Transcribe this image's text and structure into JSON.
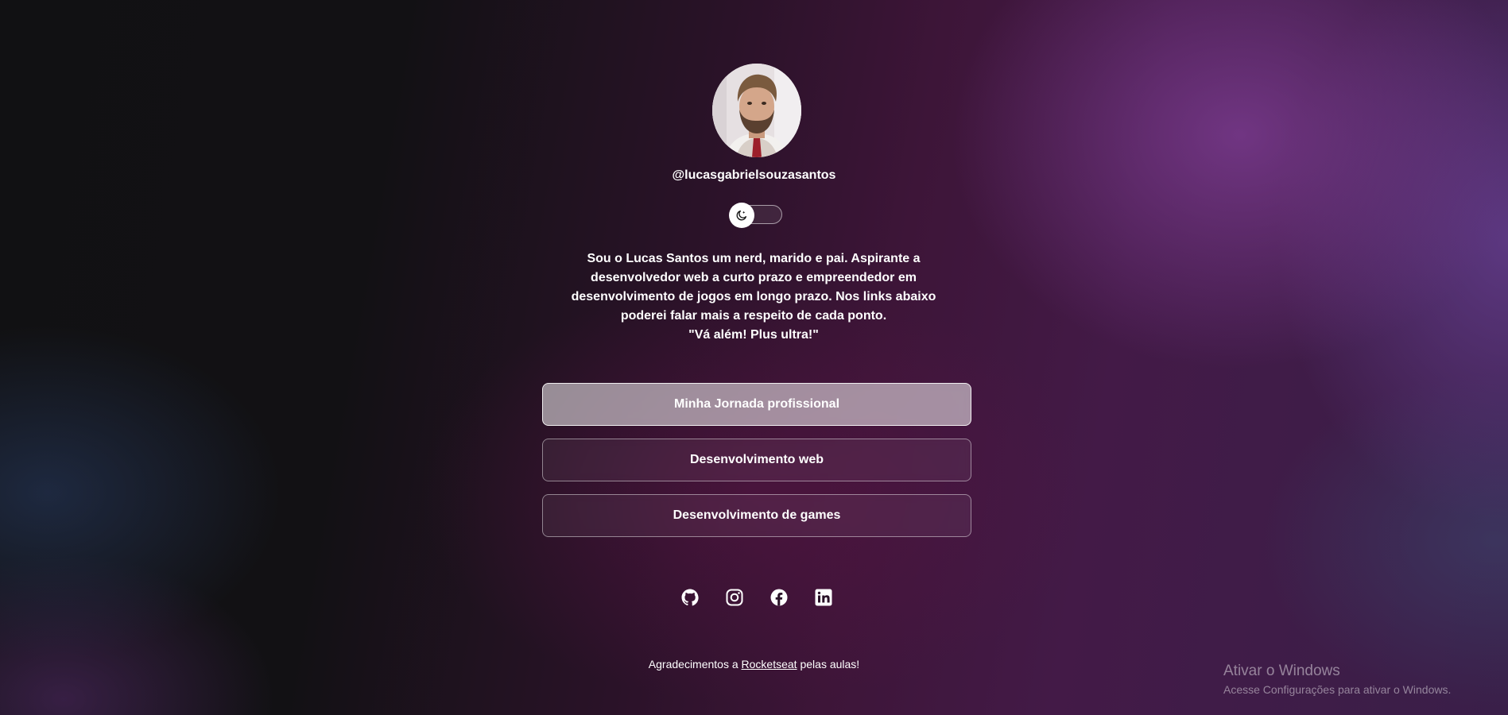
{
  "profile": {
    "username": "@lucasgabrielsouzasantos",
    "avatar_alt": "Lucas Santos"
  },
  "theme_switch": {
    "icon": "moon-icon",
    "state": "dark"
  },
  "bio": {
    "lines": [
      "Sou o Lucas Santos um nerd, marido e pai. Aspirante a",
      "desenvolvedor web a curto prazo e empreendedor em",
      "desenvolvimento de jogos em longo prazo. Nos links abaixo",
      "poderei falar mais a respeito de cada ponto.",
      "\"Vá além! Plus ultra!\""
    ]
  },
  "links": [
    {
      "label": "Minha Jornada profissional",
      "active": true
    },
    {
      "label": "Desenvolvimento web",
      "active": false
    },
    {
      "label": "Desenvolvimento de games",
      "active": false
    }
  ],
  "socials": [
    {
      "icon": "github-icon"
    },
    {
      "icon": "instagram-icon"
    },
    {
      "icon": "facebook-icon"
    },
    {
      "icon": "linkedin-icon"
    }
  ],
  "footer": {
    "prefix": "Agradecimentos a",
    "link": "Rocketseat",
    "suffix": "pelas aulas!"
  },
  "windows_watermark": {
    "title": "Ativar o Windows",
    "subtitle": "Acesse Configurações para ativar o Windows."
  },
  "colors": {
    "text": "#ffffff",
    "background_dark": "#111113",
    "background_purple": "#431a47"
  }
}
